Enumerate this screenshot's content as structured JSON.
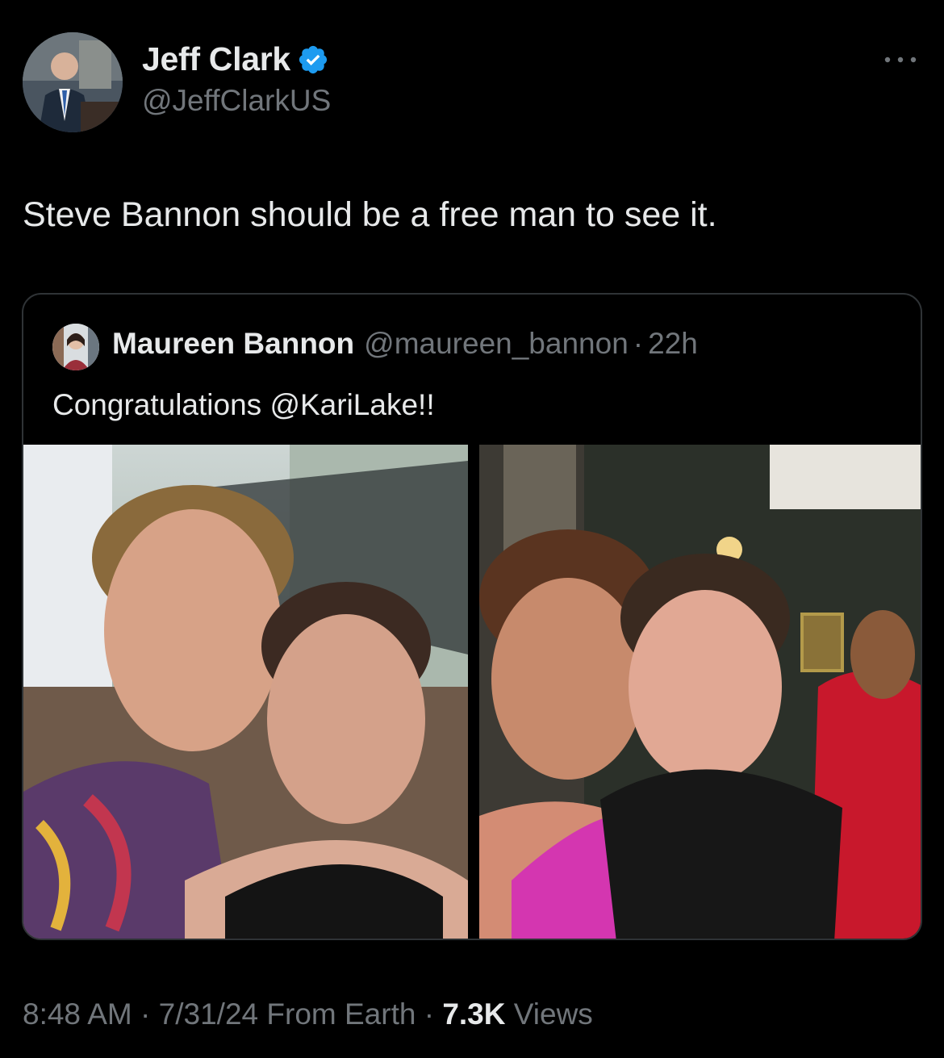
{
  "author": {
    "display_name": "Jeff Clark",
    "handle": "@JeffClarkUS",
    "verified": true,
    "verified_color": "#1d9bf0"
  },
  "tweet": {
    "text": "Steve Bannon should be a free man to see it."
  },
  "quoted_tweet": {
    "display_name": "Maureen Bannon",
    "handle": "@maureen_bannon",
    "separator": "·",
    "time": "22h",
    "text": "Congratulations @KariLake!!",
    "photo_count": 2
  },
  "meta": {
    "time": "8:48 AM",
    "date": "7/31/24",
    "source": "From Earth",
    "separator": "·",
    "views_count": "7.3K",
    "views_label": "Views"
  },
  "icons": {
    "more": "more-horizontal-icon",
    "verified": "verified-badge-icon"
  }
}
